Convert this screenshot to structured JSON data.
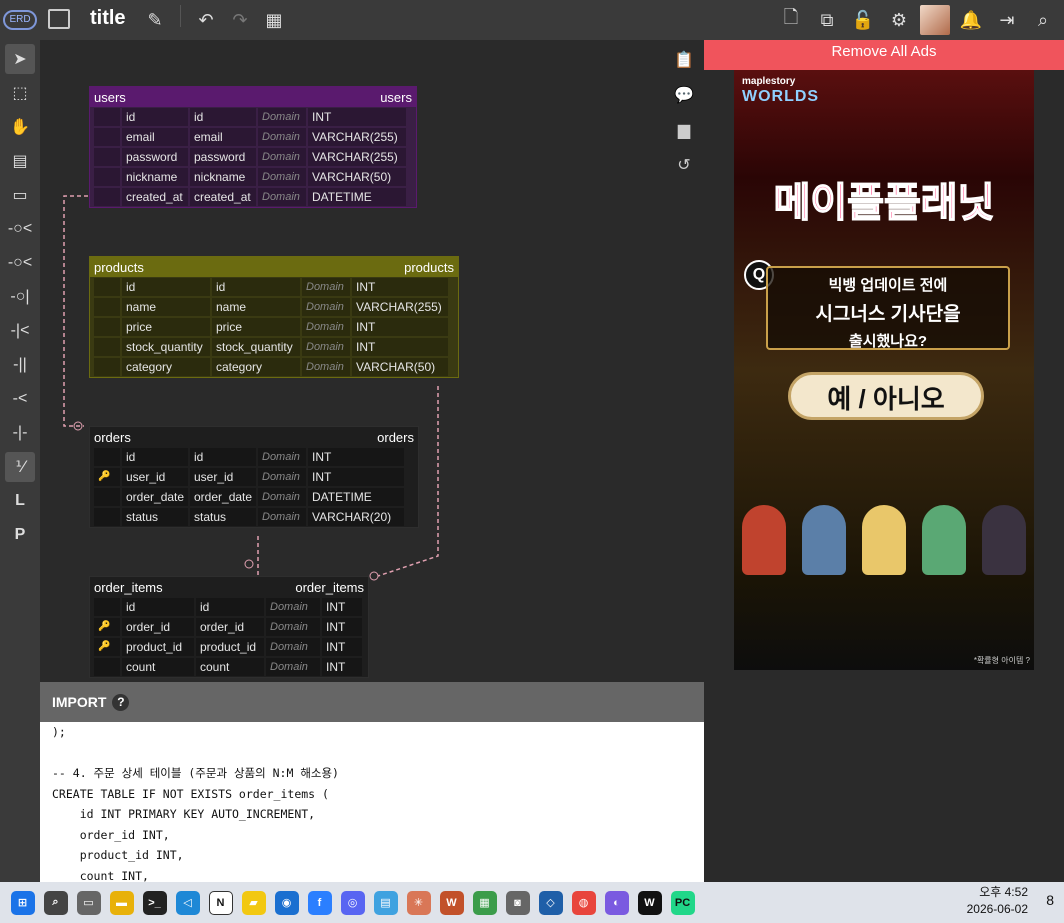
{
  "app": {
    "logo_text": "ERD",
    "title": "title"
  },
  "toolbar": {
    "left_icons": [
      "pencil-icon",
      "undo-icon",
      "redo-icon",
      "grid-icon"
    ],
    "right_icons": [
      "new-file-icon",
      "copy-icon",
      "lock-icon",
      "settings-icon",
      "avatar",
      "bell-icon",
      "login-icon",
      "search-icon"
    ]
  },
  "leftbar": {
    "items": [
      "pointer",
      "select",
      "hand",
      "table",
      "memo",
      "zero-one-n",
      "zero-n",
      "zero-one",
      "one-n",
      "one-only",
      "n-only",
      "one",
      "identification",
      "L",
      "P"
    ],
    "labels": {
      "L": "L",
      "P": "P"
    }
  },
  "rightpanel": {
    "icons": [
      "clipboard-icon",
      "comment-icon",
      "sd-icon",
      "history-icon"
    ]
  },
  "tables": {
    "users": {
      "name": "users",
      "comment": "users",
      "header_color": "#5a1a6e",
      "rows": [
        {
          "key": "",
          "name": "id",
          "logical": "id",
          "domain": "Domain",
          "type": "INT"
        },
        {
          "key": "",
          "name": "email",
          "logical": "email",
          "domain": "Domain",
          "type": "VARCHAR(255)"
        },
        {
          "key": "",
          "name": "password",
          "logical": "password",
          "domain": "Domain",
          "type": "VARCHAR(255)"
        },
        {
          "key": "",
          "name": "nickname",
          "logical": "nickname",
          "domain": "Domain",
          "type": "VARCHAR(50)"
        },
        {
          "key": "",
          "name": "created_at",
          "logical": "created_at",
          "domain": "Domain",
          "type": "DATETIME"
        }
      ]
    },
    "products": {
      "name": "products",
      "comment": "products",
      "header_color": "#6b6b10",
      "rows": [
        {
          "key": "",
          "name": "id",
          "logical": "id",
          "domain": "Domain",
          "type": "INT"
        },
        {
          "key": "",
          "name": "name",
          "logical": "name",
          "domain": "Domain",
          "type": "VARCHAR(255)"
        },
        {
          "key": "",
          "name": "price",
          "logical": "price",
          "domain": "Domain",
          "type": "INT"
        },
        {
          "key": "",
          "name": "stock_quantity",
          "logical": "stock_quantity",
          "domain": "Domain",
          "type": "INT"
        },
        {
          "key": "",
          "name": "category",
          "logical": "category",
          "domain": "Domain",
          "type": "VARCHAR(50)"
        }
      ]
    },
    "orders": {
      "name": "orders",
      "comment": "orders",
      "header_color": "#1e1e1e",
      "rows": [
        {
          "key": "",
          "name": "id",
          "logical": "id",
          "domain": "Domain",
          "type": "INT"
        },
        {
          "key": "fk",
          "name": "user_id",
          "logical": "user_id",
          "domain": "Domain",
          "type": "INT"
        },
        {
          "key": "",
          "name": "order_date",
          "logical": "order_date",
          "domain": "Domain",
          "type": "DATETIME"
        },
        {
          "key": "",
          "name": "status",
          "logical": "status",
          "domain": "Domain",
          "type": "VARCHAR(20)"
        }
      ]
    },
    "order_items": {
      "name": "order_items",
      "comment": "order_items",
      "header_color": "#1e1e1e",
      "rows": [
        {
          "key": "",
          "name": "id",
          "logical": "id",
          "domain": "Domain",
          "type": "INT"
        },
        {
          "key": "fk",
          "name": "order_id",
          "logical": "order_id",
          "domain": "Domain",
          "type": "INT"
        },
        {
          "key": "fk",
          "name": "product_id",
          "logical": "product_id",
          "domain": "Domain",
          "type": "INT"
        },
        {
          "key": "",
          "name": "count",
          "logical": "count",
          "domain": "Domain",
          "type": "INT"
        }
      ]
    }
  },
  "import": {
    "label": "IMPORT",
    "help": "?",
    "lines": [
      ");",
      "",
      "-- 4. 주문 상세 테이블 (주문과 상품의 N:M 해소용)",
      "CREATE TABLE IF NOT EXISTS order_items (",
      "    id INT PRIMARY KEY AUTO_INCREMENT,",
      "    order_id INT,",
      "    product_id INT,",
      "    count INT,"
    ]
  },
  "ad": {
    "remove_label": "Remove All Ads",
    "brand_small": "maplestory",
    "brand": "WORLDS",
    "headline": "메이플플래닛",
    "q_mark": "Q",
    "question_1": "빅뱅 업데이트 전에",
    "question_2": "시그너스 기사단을",
    "question_3": "출시했나요?",
    "answer": "예 / 아니오",
    "footer": "*확률형 아이템 ?"
  },
  "taskbar": {
    "time": "오후 4:52",
    "date": "2026-06-02",
    "apps": [
      "windows-start-icon",
      "search-icon",
      "task-view-icon",
      "file-explorer-icon",
      "terminal-icon",
      "vscode-icon",
      "notion-icon",
      "sticky-notes-icon",
      "maps-icon",
      "app-icon-f",
      "discord-icon",
      "notepad-icon",
      "claude-icon",
      "app-icon-w",
      "photos-icon",
      "camera-icon",
      "app-icon-blue",
      "chrome-icon",
      "app-icon-purple",
      "app-icon-black",
      "pycharm-icon"
    ],
    "notify_label": "8"
  }
}
